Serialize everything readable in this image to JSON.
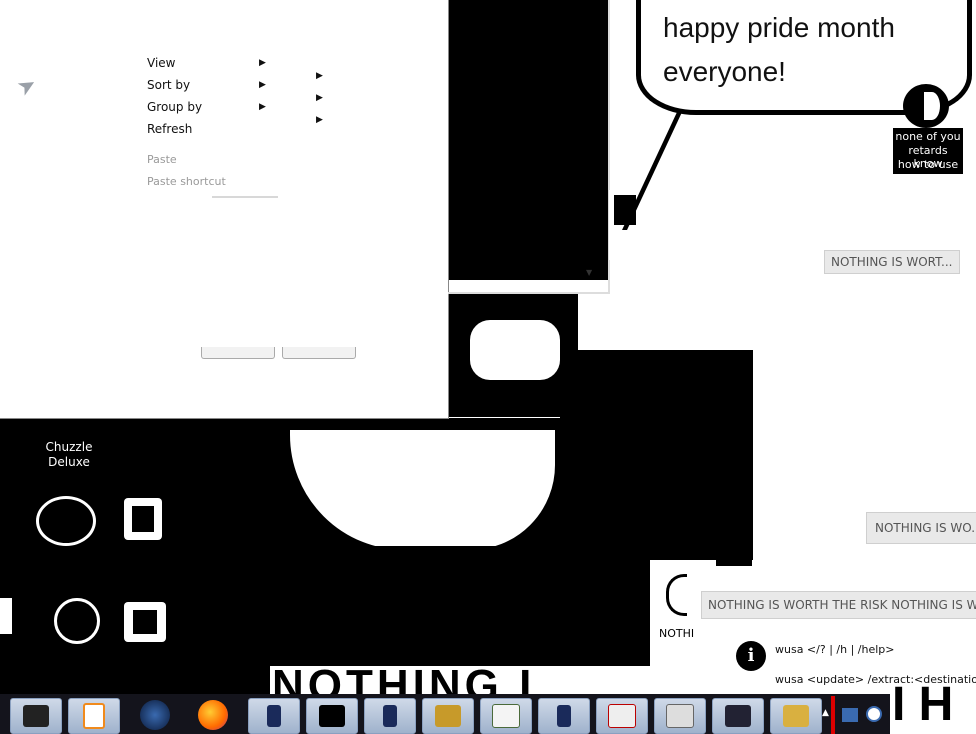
{
  "context_menu": {
    "items": [
      {
        "label": "View",
        "has_submenu": true
      },
      {
        "label": "Sort by",
        "has_submenu": true
      },
      {
        "label": "Group by",
        "has_submenu": true
      },
      {
        "label": "Refresh",
        "has_submenu": false
      }
    ],
    "disabled_items": [
      "Paste",
      "Paste shortcut"
    ]
  },
  "speech_bubble": {
    "line1": "happy pride month",
    "line2": "everyone!"
  },
  "caption": {
    "line1": "none of you",
    "line2": "retards know",
    "line3": "how to use"
  },
  "tooltips": {
    "t1": "NOTHING IS WORT...",
    "t2": "NOTHING IS WO...",
    "t3": "NOTHING IS WORTH THE RISK NOTHING IS WORTH"
  },
  "big_letters": {
    "n1": "N",
    "n2": "NOTHING I",
    "fragment": "NOTHI",
    "right": "I H"
  },
  "desktop_icons": {
    "chuzzle_line1": "Chuzzle",
    "chuzzle_line2": "Deluxe"
  },
  "info_panel": {
    "line1": "wusa </? | /h | /help>",
    "line2": "wusa <update> /extract:<destination>"
  },
  "colors": {
    "black": "#000000",
    "white": "#ffffff",
    "taskbar": "#14141c",
    "tooltip_bg": "#e9e9e9"
  },
  "taskbar_icons": [
    "explorer-icon",
    "media-player-icon",
    "globe-icon",
    "firefox-icon",
    "window-icon",
    "terminal-icon",
    "window-icon",
    "box-game-icon",
    "document-icon",
    "window-icon",
    "recorder-icon",
    "archive-icon",
    "display-icon",
    "books-icon"
  ]
}
